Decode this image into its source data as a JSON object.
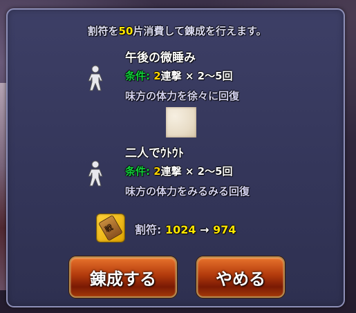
{
  "header": {
    "prefix": "割符を",
    "amount": "50",
    "suffix": "片消費して錬成を行えます。"
  },
  "skills": [
    {
      "title": "午後の微睡み",
      "condition_label": "条件:",
      "condition_count": "2",
      "condition_rest": "連撃 × 2〜5回",
      "description": "味方の体力を徐々に回復"
    },
    {
      "title": "二人でｳﾄｳﾄ",
      "condition_label": "条件:",
      "condition_count": "2",
      "condition_rest": "連撃 × 2〜5回",
      "description": "味方の体力をみるみる回復"
    }
  ],
  "token_glyph": "戦",
  "tally": {
    "label": "割符:",
    "before": "1024",
    "arrow": "→",
    "after": "974"
  },
  "buttons": {
    "craft": "錬成する",
    "cancel": "やめる"
  },
  "icons": [
    "figure-icon",
    "scroll-icon",
    "tally-token-icon"
  ],
  "colors": {
    "highlight": "#ffe600",
    "condition": "#11d23a",
    "panel": "#3d3f66"
  }
}
